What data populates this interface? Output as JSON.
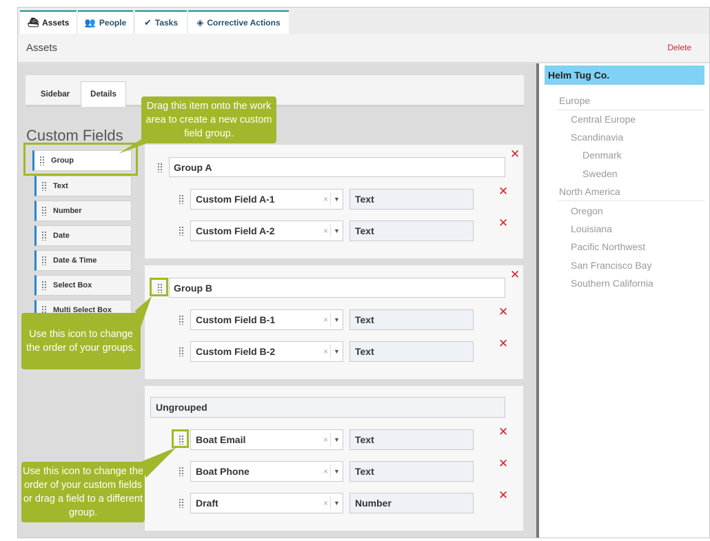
{
  "top_tabs": [
    {
      "label": "Assets",
      "icon": "boat-icon"
    },
    {
      "label": "People",
      "icon": "people-icon"
    },
    {
      "label": "Tasks",
      "icon": "tasks-icon"
    },
    {
      "label": "Corrective Actions",
      "icon": "diamond-icon"
    }
  ],
  "header": {
    "title": "Assets",
    "delete_label": "Delete"
  },
  "sub_tabs": [
    "Sidebar",
    "Details"
  ],
  "custom_fields_title": "Custom Fields",
  "palette": [
    "Group",
    "Text",
    "Number",
    "Date",
    "Date & Time",
    "Select Box",
    "Multi Select Box"
  ],
  "groups": [
    {
      "name": "Group A",
      "fields": [
        {
          "name": "Custom Field A-1",
          "type": "Text"
        },
        {
          "name": "Custom Field A-2",
          "type": "Text"
        }
      ]
    },
    {
      "name": "Group B",
      "fields": [
        {
          "name": "Custom Field B-1",
          "type": "Text"
        },
        {
          "name": "Custom Field B-2",
          "type": "Text"
        }
      ]
    }
  ],
  "ungrouped": {
    "label": "Ungrouped",
    "fields": [
      {
        "name": "Boat Email",
        "type": "Text"
      },
      {
        "name": "Boat Phone",
        "type": "Text"
      },
      {
        "name": "Draft",
        "type": "Number"
      }
    ]
  },
  "tree": {
    "root": "Helm Tug Co.",
    "items": [
      "Europe",
      "Central Europe",
      "Scandinavia",
      "Denmark",
      "Sweden",
      "North America",
      "Oregon",
      "Louisiana",
      "Pacific Northwest",
      "San Francisco Bay",
      "Southern California"
    ]
  },
  "callouts": {
    "drag_group": "Drag this item onto the work area to create a new custom field group.",
    "group_order": "Use this icon to change the order of your groups.",
    "field_order": "Use this icon to change the order of your custom fields or drag a field to a different group."
  },
  "icons": {
    "remove": "close-icon",
    "clear": "×",
    "caret": "▼"
  },
  "colors": {
    "accent": "#1b8e8e",
    "remove": "#d2232a",
    "callout": "#a2b72b",
    "tree_selected": "#7fd1f5",
    "palette_border": "#2a86c6"
  }
}
